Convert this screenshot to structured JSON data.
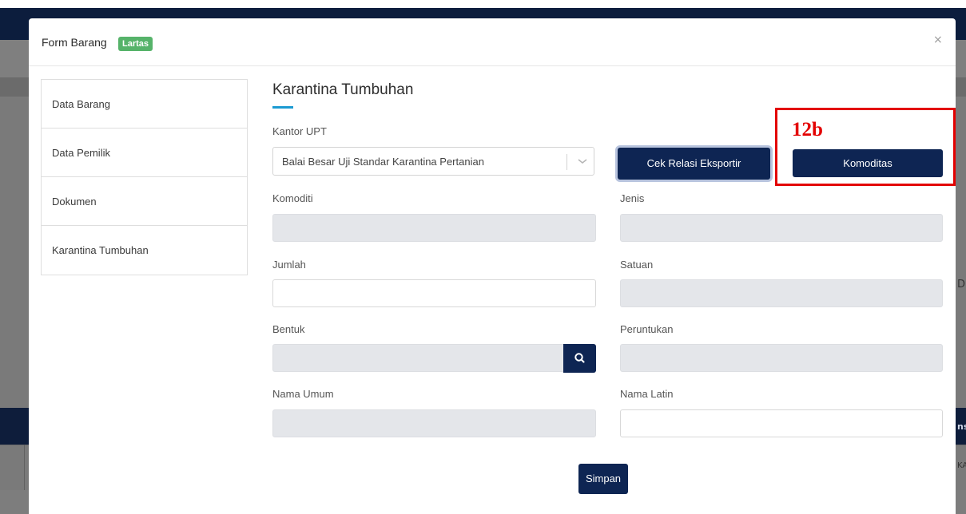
{
  "background": {
    "right_fragment_1": "DF",
    "right_fragment_2": "ns",
    "right_fragment_3": "KA"
  },
  "modal": {
    "title": "Form Barang",
    "badge": "Lartas",
    "close": "×"
  },
  "sidebar": {
    "items": [
      {
        "label": "Data Barang"
      },
      {
        "label": "Data Pemilik"
      },
      {
        "label": "Dokumen"
      },
      {
        "label": "Karantina Tumbuhan"
      }
    ]
  },
  "section": {
    "title": "Karantina Tumbuhan"
  },
  "form": {
    "kantor_upt": {
      "label": "Kantor UPT",
      "value": "Balai Besar Uji Standar Karantina Pertanian"
    },
    "cek_relasi_button": "Cek Relasi Eksportir",
    "komoditas_button": "Komoditas",
    "komoditi": {
      "label": "Komoditi",
      "value": ""
    },
    "jenis": {
      "label": "Jenis",
      "value": ""
    },
    "jumlah": {
      "label": "Jumlah",
      "value": ""
    },
    "satuan": {
      "label": "Satuan",
      "value": ""
    },
    "bentuk": {
      "label": "Bentuk",
      "value": ""
    },
    "peruntukan": {
      "label": "Peruntukan",
      "value": ""
    },
    "nama_umum": {
      "label": "Nama Umum",
      "value": ""
    },
    "nama_latin": {
      "label": "Nama Latin",
      "value": ""
    },
    "simpan_button": "Simpan"
  },
  "annotation": {
    "label": "12b",
    "color": "#e30000"
  },
  "colors": {
    "primary": "#0e2553",
    "badge": "#56b36a",
    "accent": "#1b9ad2",
    "disabled_field": "#e4e6ea"
  }
}
